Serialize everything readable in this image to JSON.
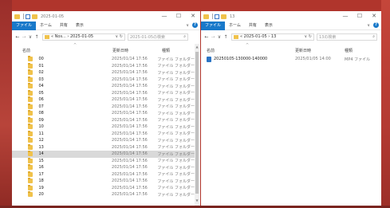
{
  "left": {
    "title": "2025-01-05",
    "tabs": [
      "ファイル",
      "ホーム",
      "共有",
      "表示"
    ],
    "address": "« Nos... › 2025-01-05",
    "search_placeholder": "2025-01-05の検索",
    "columns": {
      "name": "名前",
      "date": "更新日時",
      "type": "種類"
    },
    "rows": [
      {
        "name": "00",
        "date": "2025/01/14 17:56",
        "type": "ファイル フォルダー"
      },
      {
        "name": "01",
        "date": "2025/01/14 17:56",
        "type": "ファイル フォルダー"
      },
      {
        "name": "02",
        "date": "2025/01/14 17:56",
        "type": "ファイル フォルダー"
      },
      {
        "name": "03",
        "date": "2025/01/14 17:56",
        "type": "ファイル フォルダー"
      },
      {
        "name": "04",
        "date": "2025/01/14 17:56",
        "type": "ファイル フォルダー"
      },
      {
        "name": "05",
        "date": "2025/01/14 17:56",
        "type": "ファイル フォルダー"
      },
      {
        "name": "06",
        "date": "2025/01/14 17:56",
        "type": "ファイル フォルダー"
      },
      {
        "name": "07",
        "date": "2025/01/14 17:56",
        "type": "ファイル フォルダー"
      },
      {
        "name": "08",
        "date": "2025/01/14 17:56",
        "type": "ファイル フォルダー"
      },
      {
        "name": "09",
        "date": "2025/01/14 17:56",
        "type": "ファイル フォルダー"
      },
      {
        "name": "10",
        "date": "2025/01/14 17:56",
        "type": "ファイル フォルダー"
      },
      {
        "name": "11",
        "date": "2025/01/14 17:56",
        "type": "ファイル フォルダー"
      },
      {
        "name": "12",
        "date": "2025/01/14 17:56",
        "type": "ファイル フォルダー"
      },
      {
        "name": "13",
        "date": "2025/01/14 17:56",
        "type": "ファイル フォルダー"
      },
      {
        "name": "14",
        "date": "2025/01/14 17:56",
        "type": "ファイル フォルダー",
        "selected": true
      },
      {
        "name": "15",
        "date": "2025/01/14 17:56",
        "type": "ファイル フォルダー"
      },
      {
        "name": "16",
        "date": "2025/01/14 17:56",
        "type": "ファイル フォルダー"
      },
      {
        "name": "17",
        "date": "2025/01/14 17:56",
        "type": "ファイル フォルダー"
      },
      {
        "name": "18",
        "date": "2025/01/14 17:56",
        "type": "ファイル フォルダー"
      },
      {
        "name": "19",
        "date": "2025/01/14 17:56",
        "type": "ファイル フォルダー"
      },
      {
        "name": "20",
        "date": "2025/01/14 17:56",
        "type": "ファイル フォルダー"
      }
    ]
  },
  "right": {
    "title": "13",
    "tabs": [
      "ファイル",
      "ホーム",
      "共有",
      "表示"
    ],
    "address": "« 2025-01-05 › 13",
    "search_placeholder": "13の検索",
    "columns": {
      "name": "名前",
      "date": "更新日時",
      "type": "種類"
    },
    "rows": [
      {
        "name": "20250105-130000-140000",
        "date": "2025/01/05 14:00",
        "type": "MP4 ファイル"
      }
    ]
  },
  "icons": {
    "window_minimize": "—",
    "window_maximize": "☐",
    "window_close": "✕",
    "back": "←",
    "forward": "→",
    "dropdown": "∨",
    "up": "↑",
    "refresh": "↻",
    "search": "⌕",
    "ribbon_expand": "∨",
    "help": "?",
    "sort_caret": "^",
    "scroll_up": "▲",
    "scroll_down": "▼"
  },
  "colors": {
    "accent": "#1979ca",
    "folder": "#f0c24b",
    "selected_row": "#d9d9d9",
    "desktop": "#b0352c"
  }
}
